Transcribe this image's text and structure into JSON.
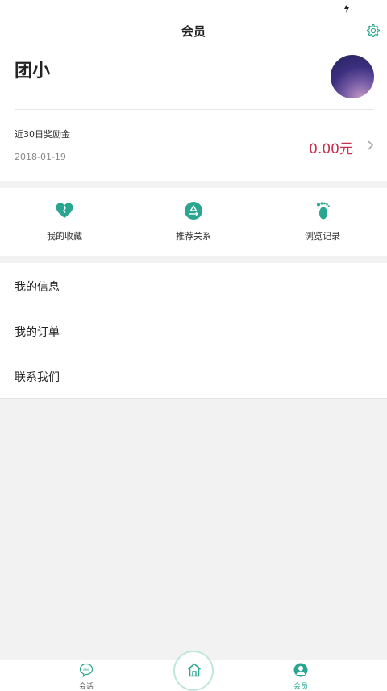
{
  "header": {
    "title": "会员"
  },
  "profile": {
    "username": "团小",
    "reward_label": "近30日奖励金",
    "reward_date": "2018-01-19",
    "reward_amount": "0.00元"
  },
  "shortcuts": [
    {
      "label": "我的收藏",
      "icon": "heart-icon"
    },
    {
      "label": "推荐关系",
      "icon": "recycle-icon"
    },
    {
      "label": "浏览记录",
      "icon": "footprint-icon"
    }
  ],
  "menu": [
    {
      "label": "我的信息"
    },
    {
      "label": "我的订单"
    },
    {
      "label": "联系我们"
    }
  ],
  "tabbar": {
    "tabs": [
      {
        "label": "会话",
        "icon": "chat-icon"
      },
      {
        "label": "会员",
        "icon": "member-icon",
        "active": true
      }
    ],
    "home_icon": "home-icon"
  },
  "colors": {
    "accent": "#2aa58f",
    "amount": "#c8314e",
    "background": "#f2f2f2"
  }
}
